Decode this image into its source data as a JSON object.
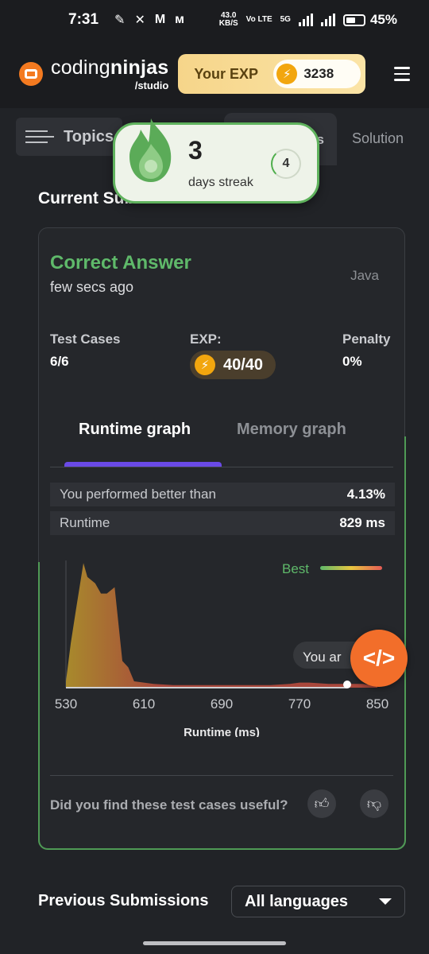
{
  "status_bar": {
    "time": "7:31",
    "net_speed_value": "43.0",
    "net_speed_unit": "KB/S",
    "volte": "Vo LTE",
    "network": "5G",
    "battery": "45%"
  },
  "header": {
    "brand_regular": "coding",
    "brand_bold": "ninjas",
    "brand_sub": "/studio",
    "exp_label": "Your EXP",
    "exp_value": "3238"
  },
  "tabs": {
    "topics_label": "Topics",
    "active_tab_partial": "ns",
    "solution_label": "Solution"
  },
  "streak": {
    "count": "3",
    "text": "days streak",
    "next": "4"
  },
  "current": {
    "title": "Current Submission",
    "verdict": "Correct Answer",
    "time": "few secs ago",
    "language": "Java",
    "test_cases_label": "Test Cases",
    "test_cases_value": "6/6",
    "exp_label": "EXP:",
    "exp_value": "40/40",
    "penalty_label": "Penalty",
    "penalty_value": "0%",
    "runtime_tab": "Runtime graph",
    "memory_tab": "Memory graph",
    "performed_label": "You performed better than",
    "performed_value": "4.13%",
    "runtime_label": "Runtime",
    "runtime_value": "829 ms",
    "feedback_question": "Did you find these test cases useful?"
  },
  "chart_data": {
    "type": "area",
    "xlabel": "Runtime (ms)",
    "ylabel": "",
    "x_ticks": [
      530,
      610,
      690,
      770,
      850
    ],
    "xlim": [
      530,
      850
    ],
    "x": [
      530,
      535,
      540,
      548,
      552,
      560,
      566,
      572,
      580,
      588,
      594,
      600,
      620,
      640,
      660,
      680,
      700,
      720,
      740,
      760,
      770,
      780,
      800,
      820,
      835,
      850
    ],
    "values": [
      5,
      35,
      60,
      98,
      87,
      82,
      74,
      74,
      79,
      21,
      16,
      5,
      3,
      2,
      2,
      2,
      2,
      2,
      2,
      3,
      4,
      4,
      3,
      3,
      3,
      1
    ],
    "ylim": [
      0,
      100
    ],
    "legend_label": "Best",
    "you_label": "You ar",
    "you_value": 829,
    "colors": {
      "best": "#5fb96a",
      "fill_top": "#b5862f",
      "fill_mid": "#b04d3e"
    }
  },
  "previous": {
    "title": "Previous Submissions",
    "language_filter": "All languages"
  }
}
